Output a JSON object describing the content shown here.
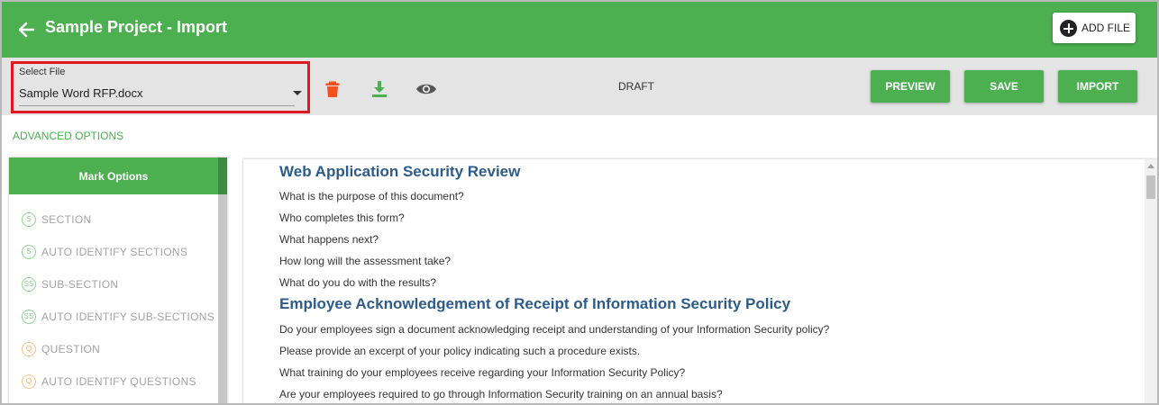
{
  "header": {
    "title": "Sample Project - Import",
    "add_file_label": "ADD FILE",
    "back_icon": "arrow-left-icon",
    "add_icon": "plus-circle-icon"
  },
  "toolbar": {
    "select_label": "Select File",
    "select_value": "Sample Word RFP.docx",
    "status": "DRAFT",
    "preview_label": "PREVIEW",
    "save_label": "SAVE",
    "import_label": "IMPORT",
    "icons": [
      "trash-icon",
      "download-icon",
      "eye-icon"
    ]
  },
  "advanced_options": "ADVANCED OPTIONS",
  "mark_options": {
    "title": "Mark Options",
    "items": [
      {
        "badge": "S",
        "label": "SECTION"
      },
      {
        "badge": "S",
        "label": "AUTO IDENTIFY SECTIONS"
      },
      {
        "badge": "SS",
        "label": "SUB-SECTION"
      },
      {
        "badge": "SS",
        "label": "AUTO IDENTIFY SUB-SECTIONS"
      },
      {
        "badge": "Q",
        "label": "QUESTION"
      },
      {
        "badge": "Q",
        "label": "AUTO IDENTIFY QUESTIONS"
      }
    ]
  },
  "document": {
    "heading1": "Web Application Security Review",
    "lines1": [
      "What is the purpose of this document?",
      "Who completes this form?",
      "What happens next?",
      "How long will the assessment take?",
      "What do you do with the results?"
    ],
    "heading2": "Employee Acknowledgement of Receipt of Information Security Policy",
    "lines2": [
      "Do your employees sign a document acknowledging receipt and understanding of your Information Security policy?",
      "Please provide an excerpt of your policy indicating such a procedure exists.",
      "What training do your employees receive regarding your Information Security Policy?",
      "Are your employees required to go through Information Security training on an annual basis?"
    ]
  },
  "colors": {
    "brand": "#4caf50",
    "highlight": "#e0191f",
    "trash": "#f4511e",
    "heading": "#2e5c8a"
  }
}
